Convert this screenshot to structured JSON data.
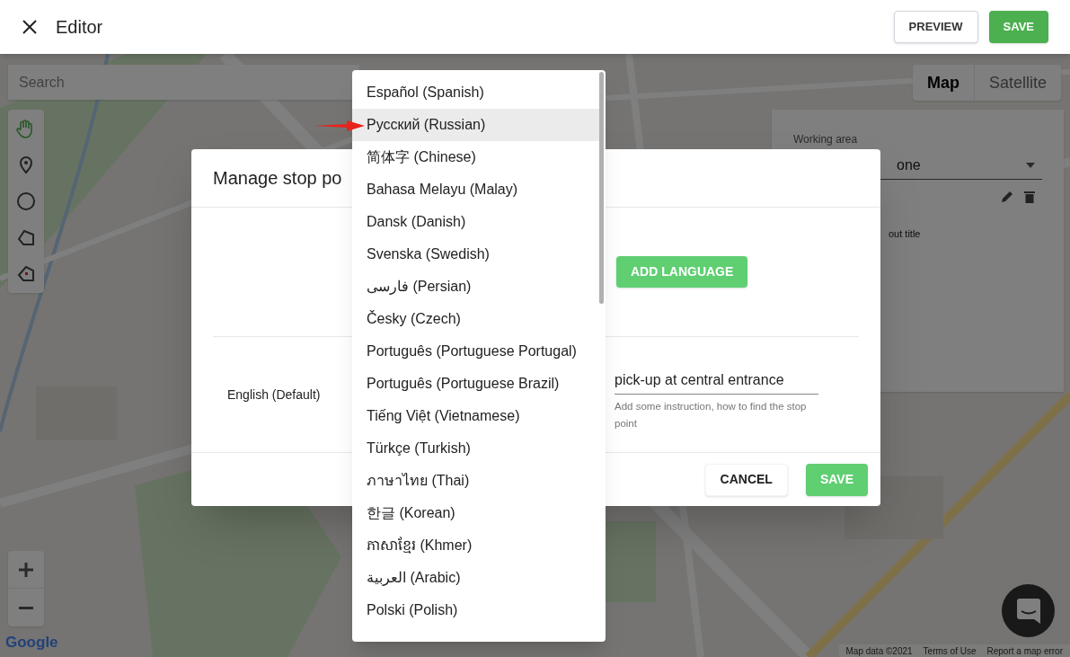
{
  "header": {
    "title": "Editor",
    "buttons": [
      {
        "label": "PREVIEW",
        "kind": "outlined"
      },
      {
        "label": "SAVE",
        "kind": "filled"
      }
    ]
  },
  "map": {
    "search": {
      "placeholder": "Search"
    },
    "tools": [
      {
        "kind": "hand",
        "selected": true
      },
      {
        "kind": "pin",
        "selected": false
      },
      {
        "kind": "circle",
        "selected": false
      },
      {
        "kind": "polygon",
        "selected": false
      },
      {
        "kind": "zone",
        "selected": false
      }
    ],
    "map_type": [
      {
        "label": "Map",
        "selected": true
      },
      {
        "label": "Satellite",
        "selected": false
      }
    ],
    "logo": "Google",
    "footer_links": [
      "Map data ©2021",
      "Terms of Use",
      "Report a map error"
    ]
  },
  "panel": {
    "label": "Working area",
    "value": "one",
    "note": "out title"
  },
  "dialog": {
    "title": "Manage stop po",
    "add_button": "ADD LANGUAGE",
    "rows": [
      {
        "language": "English (Default)",
        "value": "pick-up at central entrance",
        "helper": "Add some instruction, how to find the stop point"
      }
    ],
    "buttons": [
      {
        "label": "CANCEL",
        "kind": "text"
      },
      {
        "label": "SAVE",
        "kind": "primary"
      }
    ]
  },
  "language_menu": {
    "items": [
      {
        "label": "Español (Spanish)",
        "selected": false
      },
      {
        "label": "Русский (Russian)",
        "selected": true
      },
      {
        "label": "简体字 (Chinese)",
        "selected": false
      },
      {
        "label": "Bahasa Melayu (Malay)",
        "selected": false
      },
      {
        "label": "Dansk (Danish)",
        "selected": false
      },
      {
        "label": "Svenska (Swedish)",
        "selected": false
      },
      {
        "label": "فارسی (Persian)",
        "selected": false
      },
      {
        "label": "Česky (Czech)",
        "selected": false
      },
      {
        "label": "Português (Portuguese Portugal)",
        "selected": false
      },
      {
        "label": "Português (Portuguese Brazil)",
        "selected": false
      },
      {
        "label": "Tiếng Việt (Vietnamese)",
        "selected": false
      },
      {
        "label": "Türkçe (Turkish)",
        "selected": false
      },
      {
        "label": "ภาษาไทย (Thai)",
        "selected": false
      },
      {
        "label": "한글 (Korean)",
        "selected": false
      },
      {
        "label": "ភាសាខ្មែរ (Khmer)",
        "selected": false
      },
      {
        "label": "العربية (Arabic)",
        "selected": false
      },
      {
        "label": "Polski (Polish)",
        "selected": false
      }
    ]
  }
}
